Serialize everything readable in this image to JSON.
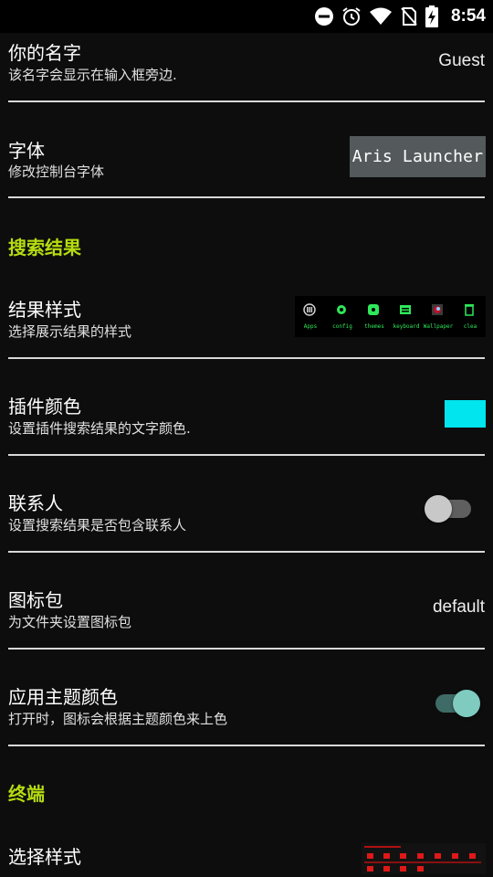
{
  "status_bar": {
    "time": "8:54",
    "icons": [
      "do-not-disturb-icon",
      "alarm-icon",
      "wifi-icon",
      "no-sim-icon",
      "battery-charging-icon"
    ]
  },
  "preferences": {
    "name": {
      "title": "你的名字",
      "summary": "该名字会显示在输入框旁边.",
      "value": "Guest"
    },
    "font": {
      "title": "字体",
      "summary": "修改控制台字体",
      "preview_text": "Aris Launcher"
    },
    "search_section": {
      "label": "搜索结果"
    },
    "result_style": {
      "title": "结果样式",
      "summary": "选择展示结果的样式",
      "preview_items": [
        "Apps",
        "config",
        "themes",
        "keyboard",
        "Wallpaper",
        "clea"
      ]
    },
    "plugin_color": {
      "title": "插件颜色",
      "summary": "设置插件搜索结果的文字颜色.",
      "color": "#00e5ee"
    },
    "contacts": {
      "title": "联系人",
      "summary": "设置搜索结果是否包含联系人",
      "enabled": false
    },
    "icon_pack": {
      "title": "图标包",
      "summary": "为文件夹设置图标包",
      "value": "default"
    },
    "theme_color": {
      "title": "应用主题颜色",
      "summary": "打开时，图标会根据主题颜色来上色",
      "enabled": true
    },
    "terminal_section": {
      "label": "终端"
    },
    "select_style": {
      "title": "选择样式"
    }
  },
  "colors": {
    "accent": "#b5dc10",
    "switch_on_thumb": "#7fcbc0",
    "switch_on_track": "#3f6b66",
    "switch_off_thumb": "#c8c8c8",
    "switch_off_track": "#5f5f5f",
    "background": "#0d0d0d"
  }
}
